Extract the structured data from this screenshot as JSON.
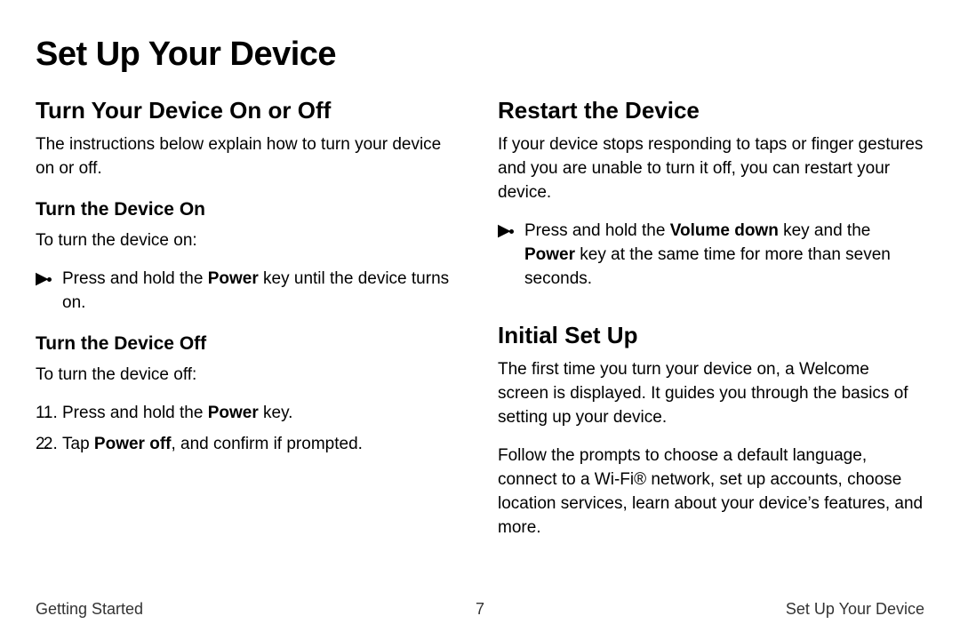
{
  "title": "Set Up Your Device",
  "left": {
    "h2": "Turn Your Device On or Off",
    "intro": "The instructions below explain how to turn your device on or off.",
    "on": {
      "h3": "Turn the Device On",
      "lead": "To turn the device on:",
      "step_pre": "Press and hold the ",
      "step_bold": "Power",
      "step_post": " key until the device turns on."
    },
    "off": {
      "h3": "Turn the Device Off",
      "lead": "To turn the device off:",
      "s1_pre": "Press and hold the ",
      "s1_bold": "Power",
      "s1_post": " key.",
      "s2_pre": "Tap ",
      "s2_bold": "Power off",
      "s2_post": ", and confirm if prompted."
    }
  },
  "right": {
    "restart": {
      "h2": "Restart the Device",
      "intro": "If your device stops responding to taps or finger gestures and you are unable to turn it off, you can restart your device.",
      "step_pre": "Press and hold the ",
      "step_bold1": "Volume down",
      "step_mid": " key and the ",
      "step_bold2": "Power",
      "step_post": " key at the same time for more than seven seconds."
    },
    "initial": {
      "h2": "Initial Set Up",
      "p1": "The first time you turn your device on, a Welcome screen is displayed. It guides you through the basics of setting up your device.",
      "p2": "Follow the prompts to choose a default language, connect to a Wi-Fi® network, set up accounts, choose location services, learn about your device’s features, and more."
    }
  },
  "footer": {
    "left": "Getting Started",
    "center": "7",
    "right": "Set Up Your Device"
  },
  "markers": {
    "triangle": "▶",
    "n1": "1.",
    "n2": "2."
  }
}
